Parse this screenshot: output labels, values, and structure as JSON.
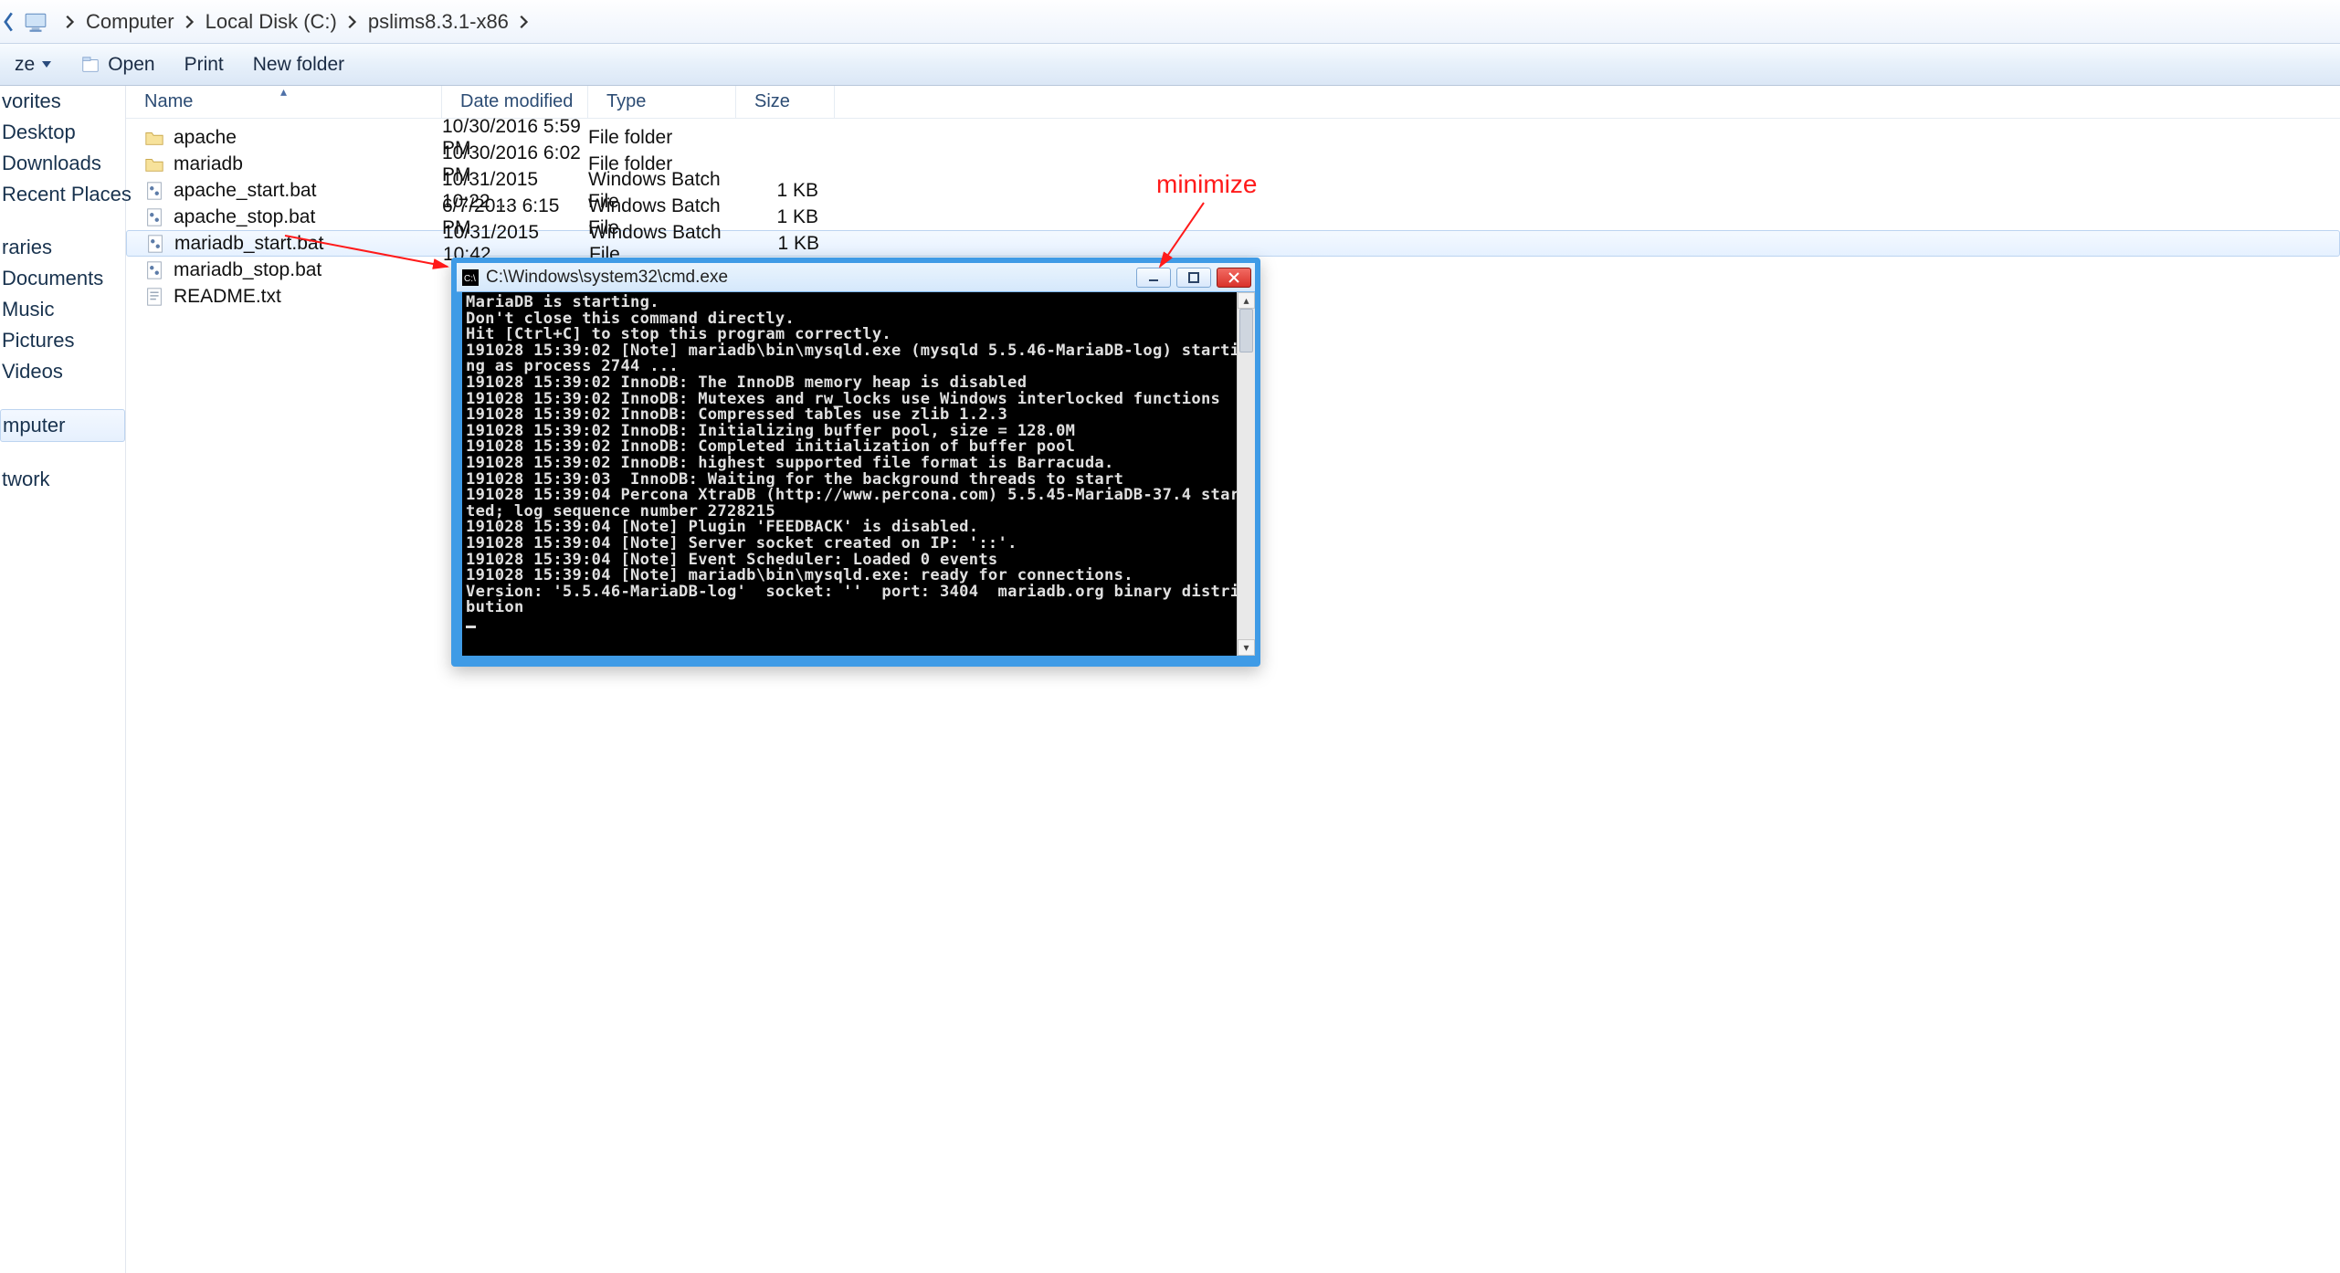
{
  "breadcrumb": {
    "segs": [
      "Computer",
      "Local Disk (C:)",
      "pslims8.3.1-x86"
    ]
  },
  "toolbar": {
    "organize": "ze",
    "open": "Open",
    "print": "Print",
    "newfolder": "New folder"
  },
  "sidebar": {
    "items": [
      {
        "label": "vorites"
      },
      {
        "label": "Desktop"
      },
      {
        "label": "Downloads"
      },
      {
        "label": "Recent Places"
      },
      {
        "label": ""
      },
      {
        "label": "raries"
      },
      {
        "label": "Documents"
      },
      {
        "label": "Music"
      },
      {
        "label": "Pictures"
      },
      {
        "label": "Videos"
      },
      {
        "label": ""
      },
      {
        "label": "mputer",
        "selected": true
      },
      {
        "label": ""
      },
      {
        "label": "twork"
      }
    ]
  },
  "columns": {
    "name": "Name",
    "date": "Date modified",
    "type": "Type",
    "size": "Size"
  },
  "rows": [
    {
      "icon": "folder",
      "name": "apache",
      "date": "10/30/2016 5:59 PM",
      "type": "File folder",
      "size": ""
    },
    {
      "icon": "folder",
      "name": "mariadb",
      "date": "10/30/2016 6:02 PM",
      "type": "File folder",
      "size": ""
    },
    {
      "icon": "bat",
      "name": "apache_start.bat",
      "date": "10/31/2015 10:22 ...",
      "type": "Windows Batch File",
      "size": "1 KB"
    },
    {
      "icon": "bat",
      "name": "apache_stop.bat",
      "date": "6/7/2013 6:15 PM",
      "type": "Windows Batch File",
      "size": "1 KB"
    },
    {
      "icon": "bat",
      "name": "mariadb_start.bat",
      "date": "10/31/2015 10:42 ...",
      "type": "Windows Batch File",
      "size": "1 KB",
      "selected": true
    },
    {
      "icon": "bat",
      "name": "mariadb_stop.bat",
      "date": "",
      "type": "",
      "size": ""
    },
    {
      "icon": "txt",
      "name": "README.txt",
      "date": "",
      "type": "",
      "size": ""
    }
  ],
  "cmd": {
    "title": "C:\\Windows\\system32\\cmd.exe",
    "lines": [
      "MariaDB is starting.",
      "Don't close this command directly.",
      "Hit [Ctrl+C] to stop this program correctly.",
      "191028 15:39:02 [Note] mariadb\\bin\\mysqld.exe (mysqld 5.5.46-MariaDB-log) starti",
      "ng as process 2744 ...",
      "191028 15:39:02 InnoDB: The InnoDB memory heap is disabled",
      "191028 15:39:02 InnoDB: Mutexes and rw_locks use Windows interlocked functions",
      "191028 15:39:02 InnoDB: Compressed tables use zlib 1.2.3",
      "191028 15:39:02 InnoDB: Initializing buffer pool, size = 128.0M",
      "191028 15:39:02 InnoDB: Completed initialization of buffer pool",
      "191028 15:39:02 InnoDB: highest supported file format is Barracuda.",
      "191028 15:39:03  InnoDB: Waiting for the background threads to start",
      "191028 15:39:04 Percona XtraDB (http://www.percona.com) 5.5.45-MariaDB-37.4 star",
      "ted; log sequence number 2728215",
      "191028 15:39:04 [Note] Plugin 'FEEDBACK' is disabled.",
      "191028 15:39:04 [Note] Server socket created on IP: '::'.",
      "191028 15:39:04 [Note] Event Scheduler: Loaded 0 events",
      "191028 15:39:04 [Note] mariadb\\bin\\mysqld.exe: ready for connections.",
      "Version: '5.5.46-MariaDB-log'  socket: ''  port: 3404  mariadb.org binary distri",
      "bution"
    ]
  },
  "annot": {
    "text": "minimize"
  }
}
